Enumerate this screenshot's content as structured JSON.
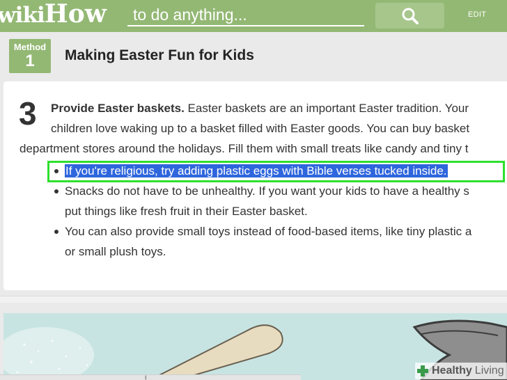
{
  "header": {
    "logo_wiki": "wiki",
    "logo_how": "How",
    "search_placeholder": "to do anything...",
    "search_icon": "search-icon",
    "edit_label": "EDIT"
  },
  "method": {
    "label": "Method",
    "number": "1",
    "title": "Making Easter Fun for Kids"
  },
  "step": {
    "number": "3",
    "heading": "Provide Easter baskets.",
    "line1_rest": " Easter baskets are an important Easter tradition. Your",
    "line2": "children love waking up to a basket filled with Easter goods. You can buy basket",
    "line3": "department stores around the holidays. Fill them with small treats like candy and tiny t",
    "bullets": [
      {
        "lines": [
          "If you're religious, try adding plastic eggs with Bible verses tucked inside."
        ],
        "highlighted": true
      },
      {
        "lines": [
          "Snacks do not have to be unhealthy. If you want your kids to have a healthy s",
          "put things like fresh fruit in their Easter basket."
        ],
        "highlighted": false
      },
      {
        "lines": [
          "You can also provide small toys instead of food-based items, like tiny plastic a",
          "or small plush toys."
        ],
        "highlighted": false
      }
    ]
  },
  "image": {
    "watermark_healthy": "Healthy",
    "watermark_living": "Living",
    "watermark_icon": "health-cross-icon"
  },
  "colors": {
    "header_green": "#93b874",
    "highlight_blue": "#2f66dd",
    "highlight_border": "#2ee02e",
    "image_bg": "#c7e4e2"
  }
}
